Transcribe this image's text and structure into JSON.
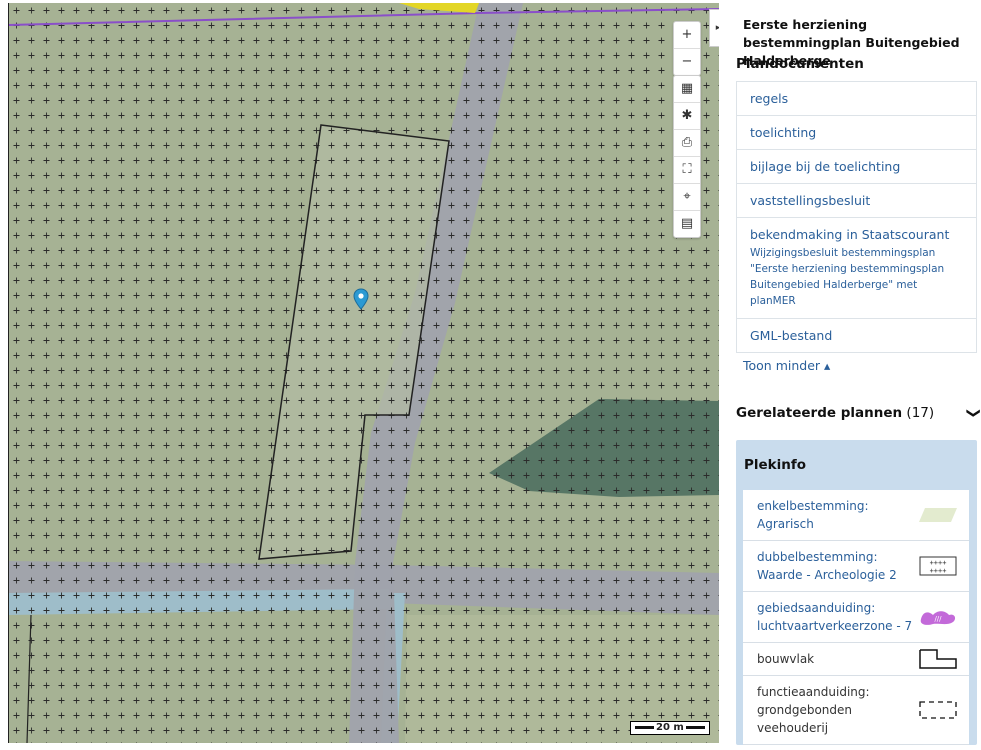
{
  "map": {
    "controls": [
      {
        "name": "zoom-in-button",
        "icon": "+"
      },
      {
        "name": "zoom-out-button",
        "icon": "−"
      }
    ],
    "tools": [
      {
        "name": "layers-icon",
        "icon": "▦"
      },
      {
        "name": "settings-gear-icon",
        "icon": "✱"
      },
      {
        "name": "print-icon",
        "icon": "⎙"
      },
      {
        "name": "fullscreen-icon",
        "icon": "⛶"
      },
      {
        "name": "locate-icon",
        "icon": "⌖"
      },
      {
        "name": "legend-list-icon",
        "icon": "▤"
      }
    ],
    "panel_toggle": "▸",
    "scale_label": "20 m",
    "colors": {
      "base": "#a4b091",
      "grey_road": "#a0a3ac",
      "water": "#9fbcc9",
      "dark_area": "#4e6e5e",
      "plot_outline": "#222222"
    }
  },
  "panel": {
    "title": "Eerste herziening bestemmingplan Buitengebied Halderberge",
    "docs_heading": "Plandocumenten",
    "docs": [
      {
        "label": "regels"
      },
      {
        "label": "toelichting"
      },
      {
        "label": "bijlage bij de toelichting"
      },
      {
        "label": "vaststellingsbesluit"
      },
      {
        "label": "bekendmaking in Staatscourant",
        "sub": "Wijzigingsbesluit bestemmingsplan \"Eerste herziening bestemmingsplan Buitengebied Halderberge\" met planMER"
      },
      {
        "label": "GML-bestand"
      }
    ],
    "toon_minder": "Toon minder ▴",
    "related": {
      "label": "Gerelateerde plannen",
      "count": "(17)",
      "chevron": "❯"
    },
    "plekinfo": {
      "heading": "Plekinfo",
      "items": [
        {
          "label": "enkelbestemming: Agrarisch",
          "legend": "agrarisch-swatch"
        },
        {
          "label": "dubbelbestemming: Waarde - Archeologie 2",
          "legend": "cross-hatch-swatch"
        },
        {
          "label": "gebiedsaanduiding: luchtvaartverkeerzone - 7",
          "legend": "purple-zone-swatch"
        },
        {
          "label": "bouwvlak",
          "legend": "bouwvlak-outline-swatch"
        },
        {
          "label": "functieaanduiding: grondgebonden veehouderij",
          "legend": "dashed-outline-swatch"
        }
      ]
    }
  }
}
